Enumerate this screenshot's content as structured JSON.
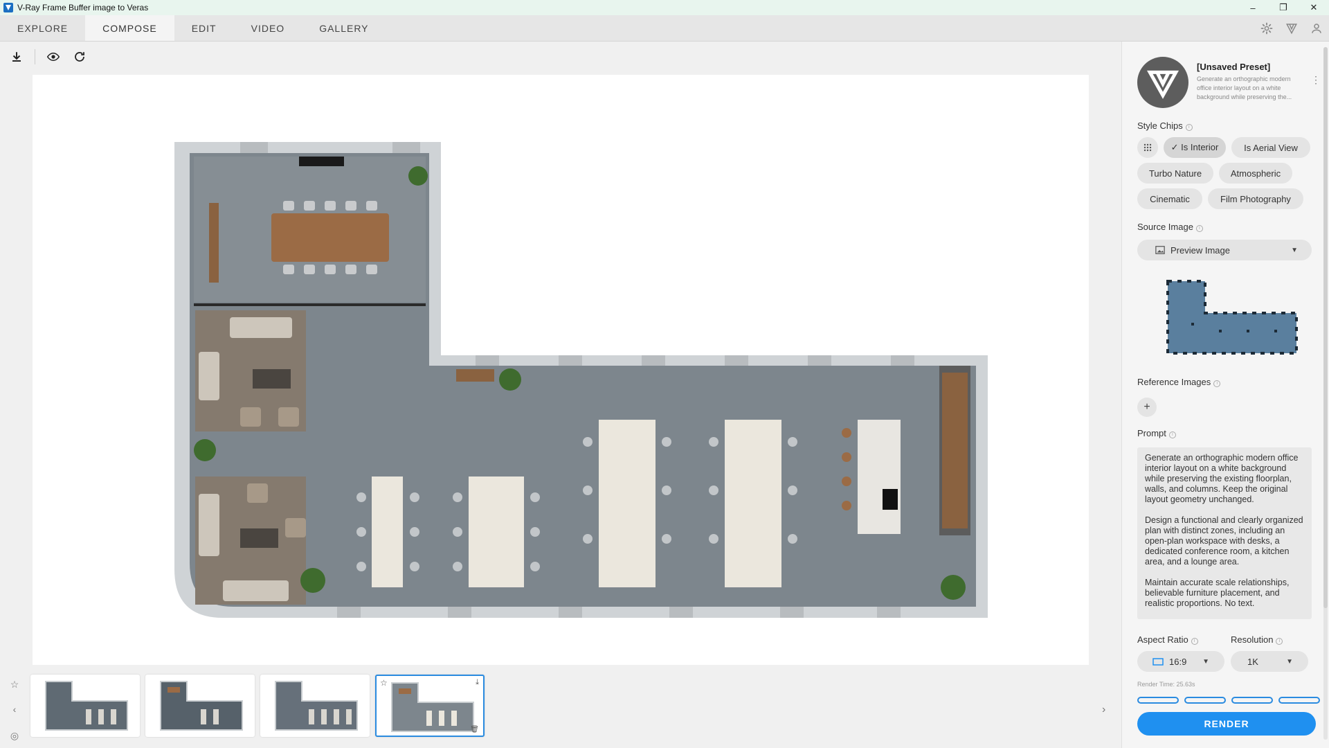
{
  "window": {
    "title": "V-Ray Frame Buffer image to Veras",
    "minimize": "–",
    "maximize": "❐",
    "close": "✕"
  },
  "nav": {
    "tabs": [
      {
        "label": "EXPLORE"
      },
      {
        "label": "COMPOSE"
      },
      {
        "label": "EDIT"
      },
      {
        "label": "VIDEO"
      },
      {
        "label": "GALLERY"
      }
    ],
    "active_tab": "COMPOSE"
  },
  "preset": {
    "title": "[Unsaved Preset]",
    "description": "Generate an orthographic modern office interior layout on a white background while preserving the...",
    "menu": "⋮"
  },
  "style_chips": {
    "label": "Style Chips",
    "chips": [
      {
        "label": "✓ Is Interior",
        "selected": true
      },
      {
        "label": "Is Aerial View",
        "selected": false
      },
      {
        "label": "Turbo Nature",
        "selected": false
      },
      {
        "label": "Atmospheric",
        "selected": false
      },
      {
        "label": "Cinematic",
        "selected": false
      },
      {
        "label": "Film Photography",
        "selected": false
      }
    ]
  },
  "source_image": {
    "label": "Source Image",
    "selected": "Preview Image"
  },
  "reference_images": {
    "label": "Reference Images",
    "add": "+"
  },
  "prompt": {
    "label": "Prompt",
    "paragraphs": [
      "Generate an orthographic modern office interior layout on a white background while preserving the existing floorplan, walls, and columns. Keep the original layout geometry unchanged.",
      "Design a functional and clearly organized plan with distinct zones, including an open-plan workspace with desks, a dedicated conference room, a kitchen area, and a lounge area.",
      "Maintain accurate scale relationships, believable furniture placement, and realistic proportions. No text."
    ]
  },
  "aspect_ratio": {
    "label": "Aspect Ratio",
    "value": "16:9"
  },
  "resolution": {
    "label": "Resolution",
    "value": "1K"
  },
  "render": {
    "time": "Render Time: 25.63s",
    "button": "RENDER"
  },
  "gallery_strip": {
    "thumbnail_count": 4,
    "selected_index": 3
  },
  "colors": {
    "accent": "#1f90f0",
    "floor": "#7d868d",
    "wall": "#cfd3d6",
    "desk": "#ebe7dd",
    "table": "#9b6b45"
  }
}
